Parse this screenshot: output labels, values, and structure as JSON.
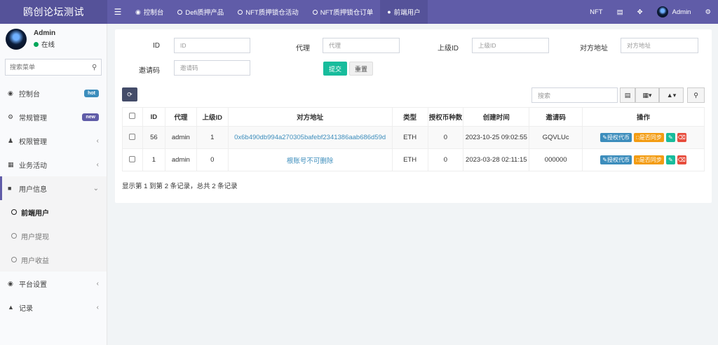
{
  "app": {
    "title": "鸥创论坛测试"
  },
  "topnav": {
    "items": [
      {
        "label": "控制台",
        "icon": "dashboard-icon"
      },
      {
        "label": "Defi质押产品",
        "icon": "circle-icon"
      },
      {
        "label": "NFT质押锁仓活动",
        "icon": "circle-icon"
      },
      {
        "label": "NFT质押锁仓订单",
        "icon": "circle-icon"
      },
      {
        "label": "前端用户",
        "icon": "user-icon"
      }
    ],
    "right": {
      "nft_label": "NFT",
      "user_name": "Admin"
    }
  },
  "sidebar": {
    "user": {
      "name": "Admin",
      "status": "在线"
    },
    "search_placeholder": "搜索菜单",
    "items": [
      {
        "label": "控制台",
        "badge": "hot",
        "badge_color": "#3c8dbc"
      },
      {
        "label": "常规管理",
        "badge": "new",
        "badge_color": "#605ca8"
      },
      {
        "label": "权限管理"
      },
      {
        "label": "业务活动"
      },
      {
        "label": "用户信息"
      },
      {
        "label": "平台设置"
      },
      {
        "label": "记录"
      }
    ],
    "sub_items": [
      {
        "label": "前端用户"
      },
      {
        "label": "用户提现"
      },
      {
        "label": "用户收益"
      }
    ]
  },
  "form": {
    "id_label": "ID",
    "id_placeholder": "ID",
    "agent_label": "代理",
    "agent_placeholder": "代理",
    "parent_label": "上级ID",
    "parent_placeholder": "上级ID",
    "address_label": "对方地址",
    "address_placeholder": "对方地址",
    "invite_label": "邀请码",
    "invite_placeholder": "邀请码",
    "submit_label": "提交",
    "reset_label": "重置"
  },
  "toolbar": {
    "search_placeholder": "搜索"
  },
  "table": {
    "headers": [
      "ID",
      "代理",
      "上级ID",
      "对方地址",
      "类型",
      "授权币种数",
      "创建时间",
      "邀请码",
      "操作"
    ],
    "rows": [
      {
        "id": "56",
        "agent": "admin",
        "parent": "1",
        "address": "0x6b490db994a270305bafebf2341386aab686d59d",
        "type": "ETH",
        "count": "0",
        "created": "2023-10-25 09:02:55",
        "code": "GQVLUc"
      },
      {
        "id": "1",
        "agent": "admin",
        "parent": "0",
        "address": "根账号不可删除",
        "type": "ETH",
        "count": "0",
        "created": "2023-03-28 02:11:15",
        "code": "000000"
      }
    ],
    "op_auth": "授权代币",
    "op_sync": "是否同步"
  },
  "pagination": {
    "summary": "显示第 1 到第 2 条记录，总共 2 条记录"
  }
}
